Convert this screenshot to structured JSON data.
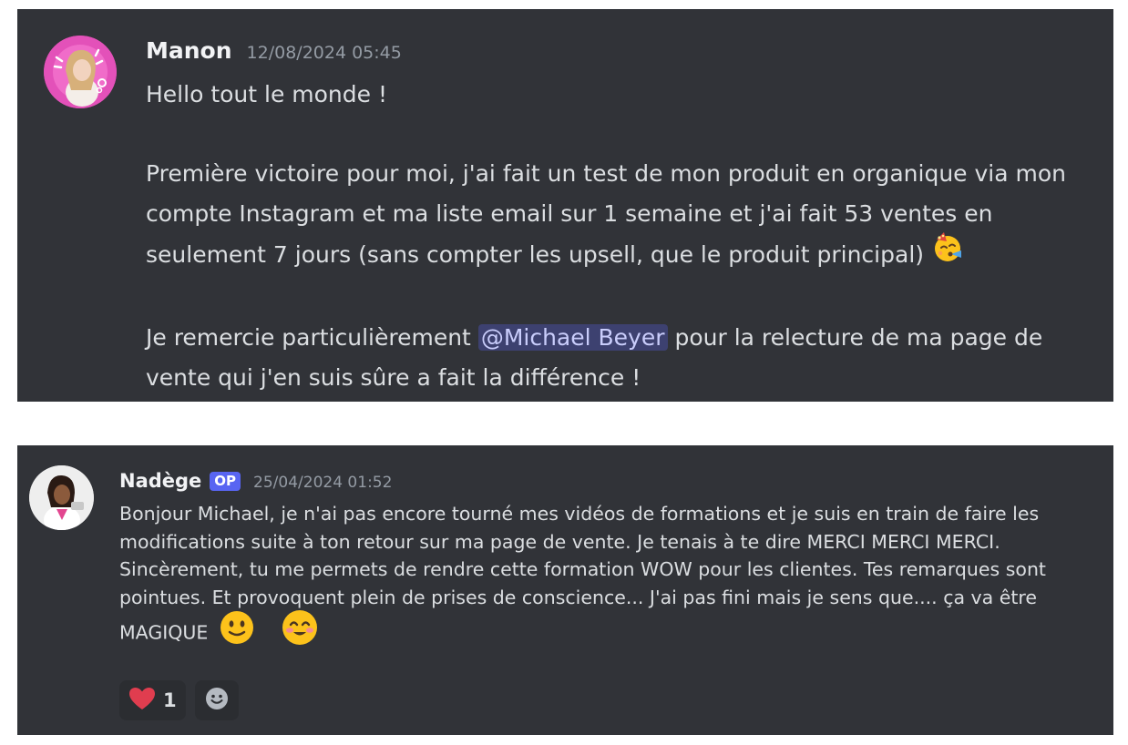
{
  "messages": [
    {
      "username": "Manon",
      "timestamp": "12/08/2024 05:45",
      "avatar_color": "#e351b9",
      "greeting": "Hello tout le monde !",
      "para2": "Première victoire pour moi, j'ai fait un test de mon produit en organique via mon compte Instagram et ma liste email sur 1 semaine et j'ai fait 53 ventes en seulement 7 jours (sans compter les upsell, que le produit principal)",
      "para2_emoji": "partying-face-emoji",
      "para3_before": "Je remercie particulièrement",
      "mention": "@Michael Beyer",
      "para3_after": "pour la relecture de ma page de vente qui j'en suis sûre a fait la différence !"
    },
    {
      "username": "Nadège",
      "badge": "OP",
      "timestamp": "25/04/2024 01:52",
      "text": "Bonjour Michael, je n'ai pas encore tourné mes vidéos de formations et je suis en train de faire les modifications suite à ton retour sur ma page de vente. Je tenais à te dire MERCI MERCI MERCI. Sincèrement, tu me permets de rendre cette formation WOW pour les clientes. Tes remarques sont pointues. Et provoquent plein de prises de conscience... J'ai pas fini mais je sens que.... ça va être MAGIQUE",
      "emojis": [
        "slightly-smiling-face-emoji",
        "smiling-face-with-smiling-eyes-emoji"
      ],
      "reactions": [
        {
          "icon": "heart-icon",
          "count": "1"
        },
        {
          "icon": "add-reaction-icon"
        }
      ]
    }
  ],
  "colors": {
    "background": "#313338",
    "text": "#dbdee1",
    "username": "#f2f3f5",
    "timestamp": "#949ba4",
    "op_badge": "#5865f2",
    "heart": "#e03d4f",
    "emoji_yellow": "#fcc21b"
  }
}
